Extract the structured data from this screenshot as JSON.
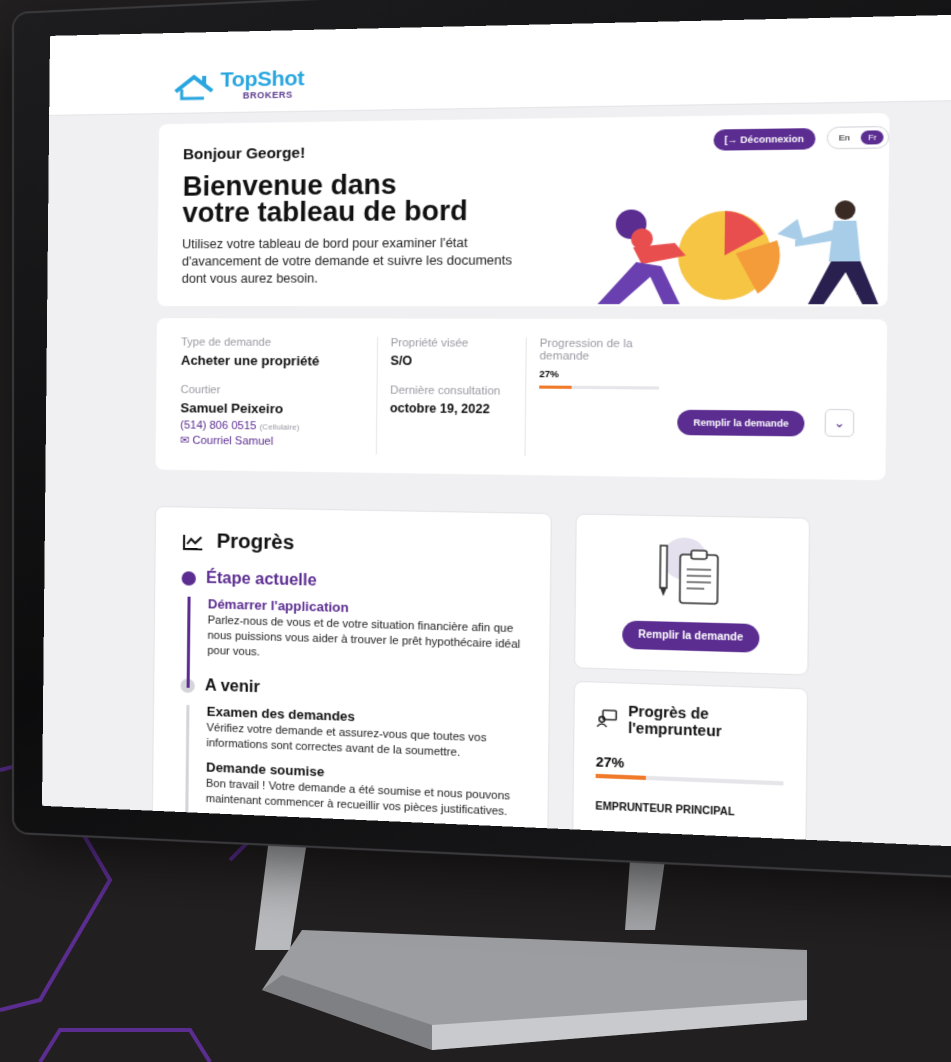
{
  "brand": {
    "name": "TopShot",
    "sub": "BROKERS",
    "primary": "#5b2d91",
    "accent": "#29a6e0",
    "orange": "#f07a2a"
  },
  "header": {
    "logout_label": "[→ Déconnexion",
    "lang_en": "En",
    "lang_fr": "Fr"
  },
  "welcome": {
    "greeting": "Bonjour George!",
    "title": "Bienvenue dans votre tableau de bord",
    "lead": "Utilisez votre tableau de bord pour examiner l'état d'avancement de votre demande et suivre les documents dont vous aurez besoin."
  },
  "summary": {
    "request_type_label": "Type de demande",
    "request_type_value": "Acheter une propriété",
    "broker_label": "Courtier",
    "broker_name": "Samuel Peixeiro",
    "broker_phone": "(514) 806 0515",
    "broker_phone_type": "(Cellulaire)",
    "broker_email": "✉ Courriel Samuel",
    "property_label": "Propriété visée",
    "property_value": "S/O",
    "last_consult_label": "Dernière consultation",
    "last_consult_value": "octobre 19, 2022",
    "progress_label": "Progression de la demande",
    "progress_value": "27%",
    "progress_fraction": 0.27,
    "fill_button": "Remplir la demande"
  },
  "progress": {
    "title": "Progrès",
    "current_heading": "Étape actuelle",
    "current_step_title": "Démarrer l'application",
    "current_step_desc": "Parlez-nous de vous et de votre situation financière afin que nous puissions vous aider à trouver le prêt hypothécaire idéal pour vous.",
    "upcoming_heading": "A venir",
    "step2_title": "Examen des demandes",
    "step2_desc": "Vérifiez votre demande et assurez-vous que toutes vos informations sont correctes avant de la soumettre.",
    "step3_title": "Demande soumise",
    "step3_desc": "Bon travail ! Votre demande a été soumise et nous pouvons maintenant commencer à recueillir vos pièces justificatives."
  },
  "apply_card": {
    "button": "Remplir la demande"
  },
  "borrower": {
    "title": "Progrès de l'emprunteur",
    "pct": "27%",
    "fraction": 0.27,
    "primary_label": "EMPRUNTEUR PRINCIPAL"
  }
}
